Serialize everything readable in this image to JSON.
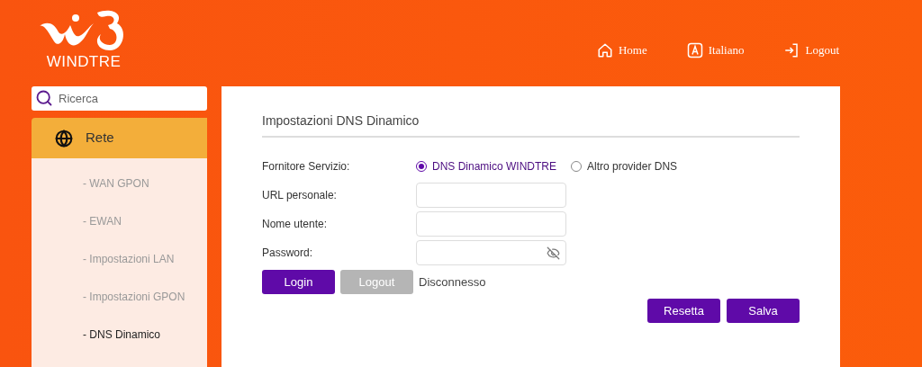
{
  "header": {
    "brand": "WINDTRE",
    "nav": [
      {
        "kind": "home",
        "label": "Home"
      },
      {
        "kind": "language",
        "label": "Italiano"
      },
      {
        "kind": "logout",
        "label": "Logout"
      }
    ]
  },
  "sidebar": {
    "search": {
      "placeholder": "Ricerca"
    },
    "section": {
      "label": "Rete",
      "expanded": true
    },
    "items": [
      {
        "label": "- WAN GPON",
        "selected": false
      },
      {
        "label": "- EWAN",
        "selected": false
      },
      {
        "label": "- Impostazioni LAN",
        "selected": false
      },
      {
        "label": "- Impostazioni GPON",
        "selected": false
      },
      {
        "label": "- DNS Dinamico",
        "selected": true
      }
    ]
  },
  "panel": {
    "title": "Impostazioni DNS Dinamico",
    "provider": {
      "label": "Fornitore Servizio:",
      "options": [
        {
          "label": "DNS Dinamico WINDTRE",
          "selected": true
        },
        {
          "label": "Altro provider DNS",
          "selected": false
        }
      ]
    },
    "fields": [
      {
        "kind": "text",
        "label": "URL personale:"
      },
      {
        "kind": "text",
        "label": "Nome utente:"
      },
      {
        "kind": "password",
        "label": "Password:"
      }
    ],
    "account_buttons": [
      {
        "label": "Login",
        "disabled": false
      },
      {
        "label": "Logout",
        "disabled": true
      }
    ],
    "status": "Disconnesso",
    "actions": [
      {
        "label": "Resetta"
      },
      {
        "label": "Salva"
      }
    ]
  }
}
